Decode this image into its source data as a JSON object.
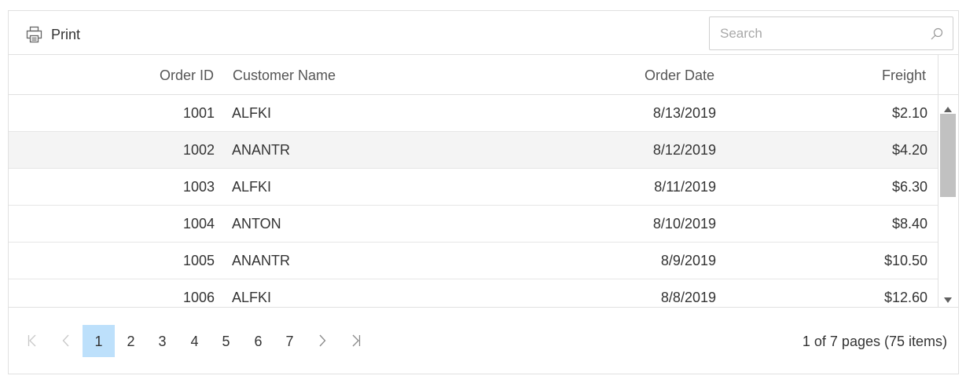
{
  "toolbar": {
    "print_label": "Print",
    "search_placeholder": "Search",
    "search_value": ""
  },
  "columns": {
    "order_id": "Order ID",
    "customer_name": "Customer Name",
    "order_date": "Order Date",
    "freight": "Freight"
  },
  "rows": [
    {
      "order_id": "1001",
      "customer_name": "ALFKI",
      "order_date": "8/13/2019",
      "freight": "$2.10"
    },
    {
      "order_id": "1002",
      "customer_name": "ANANTR",
      "order_date": "8/12/2019",
      "freight": "$4.20"
    },
    {
      "order_id": "1003",
      "customer_name": "ALFKI",
      "order_date": "8/11/2019",
      "freight": "$6.30"
    },
    {
      "order_id": "1004",
      "customer_name": "ANTON",
      "order_date": "8/10/2019",
      "freight": "$8.40"
    },
    {
      "order_id": "1005",
      "customer_name": "ANANTR",
      "order_date": "8/9/2019",
      "freight": "$10.50"
    },
    {
      "order_id": "1006",
      "customer_name": "ALFKI",
      "order_date": "8/8/2019",
      "freight": "$12.60"
    }
  ],
  "pager": {
    "pages": [
      "1",
      "2",
      "3",
      "4",
      "5",
      "6",
      "7"
    ],
    "current_page": "1",
    "info": "1 of 7 pages (75 items)"
  },
  "icons": {
    "print": "printer-icon",
    "search": "search-icon",
    "first": "first-page-icon",
    "prev": "previous-page-icon",
    "next": "next-page-icon",
    "last": "last-page-icon"
  },
  "colors": {
    "active_page": "#bde0fb",
    "alt_row": "#f4f4f4",
    "scroll_thumb": "#c1c1c1"
  }
}
